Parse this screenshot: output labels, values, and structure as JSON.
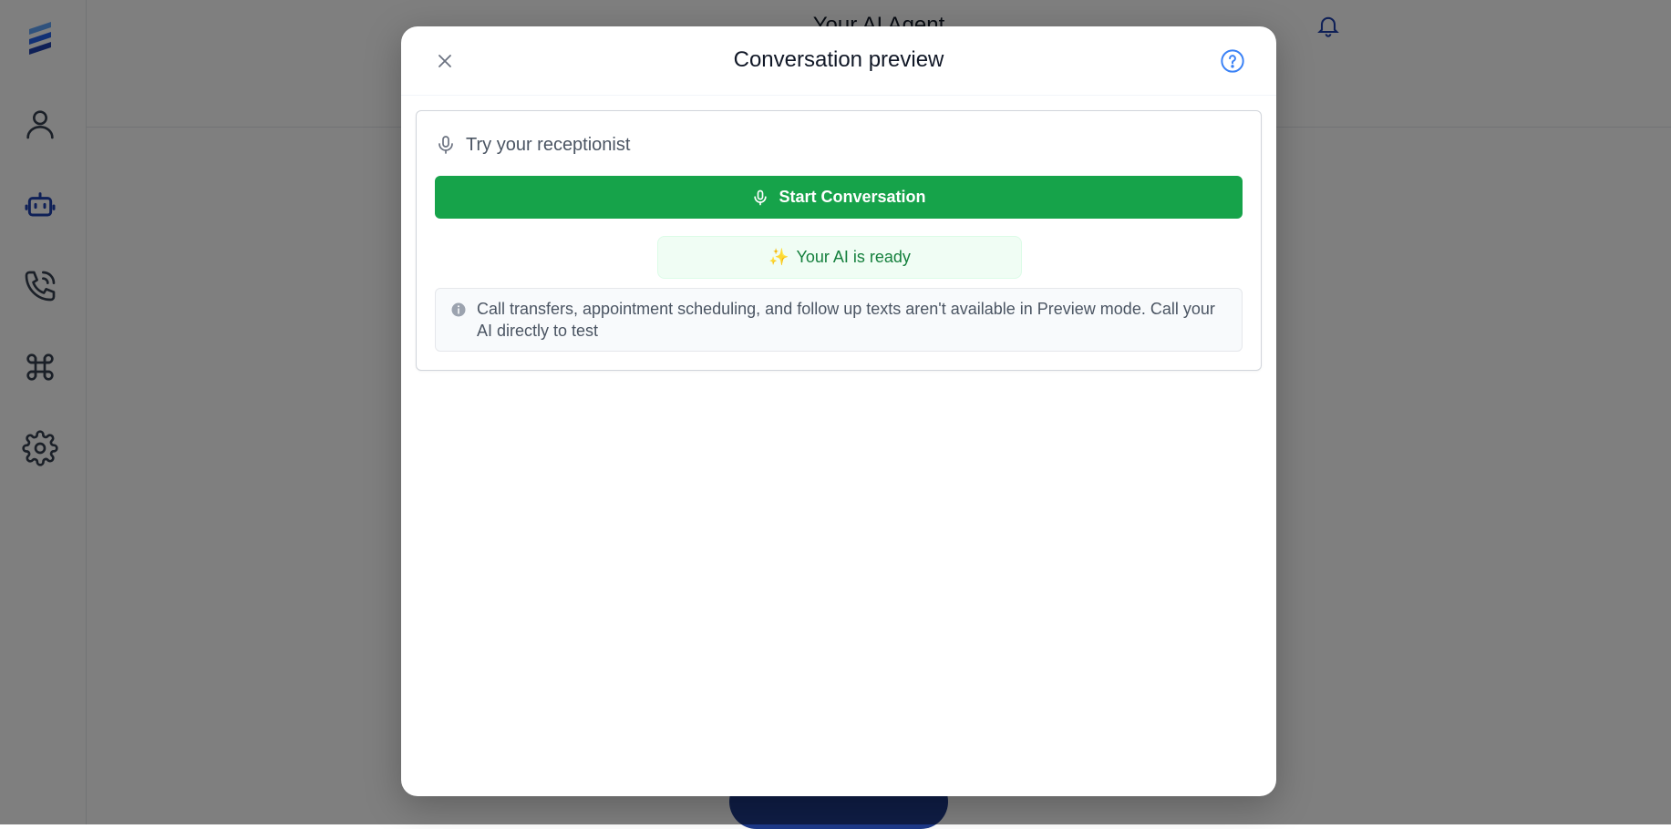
{
  "app": {
    "page_title": "Your AI Agent",
    "sidebar": {
      "logo_icon": "stack-logo-icon",
      "items": [
        {
          "icon": "user-icon"
        },
        {
          "icon": "robot-icon",
          "active": true
        },
        {
          "icon": "phone-icon"
        },
        {
          "icon": "command-icon"
        },
        {
          "icon": "gear-icon"
        }
      ]
    }
  },
  "modal": {
    "title": "Conversation preview",
    "close_icon": "close-icon",
    "help_icon": "help-circle-icon",
    "card": {
      "heading": "Try your receptionist",
      "heading_icon": "microphone-icon",
      "start_button_label": "Start Conversation",
      "start_button_icon": "microphone-icon",
      "status_badge": "Your AI is ready",
      "status_icon": "sparkles-icon",
      "notice": "Call transfers, appointment scheduling, and follow up texts aren't available in Preview mode. Call your AI directly to test",
      "notice_icon": "info-icon"
    }
  },
  "colors": {
    "accent_green": "#16a34a",
    "ready_text": "#15803d",
    "brand_blue": "#1e40af",
    "overlay": "rgba(0,0,0,0.5)"
  }
}
